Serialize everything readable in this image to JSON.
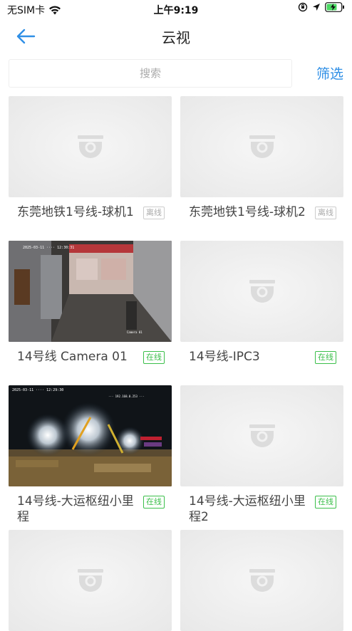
{
  "status_bar": {
    "carrier": "无SIM卡",
    "time": "上午9:19"
  },
  "nav": {
    "title": "云视"
  },
  "search": {
    "placeholder": "搜索",
    "filter_label": "筛选"
  },
  "cameras": [
    {
      "name": "东莞地铁1号线-球机1",
      "status": "离线",
      "online": false,
      "has_snapshot": false
    },
    {
      "name": "东莞地铁1号线-球机2",
      "status": "离线",
      "online": false,
      "has_snapshot": false
    },
    {
      "name": "14号线 Camera 01",
      "status": "在线",
      "online": true,
      "has_snapshot": true
    },
    {
      "name": "14号线-IPC3",
      "status": "在线",
      "online": true,
      "has_snapshot": false
    },
    {
      "name": "14号线-大运枢纽小里程",
      "status": "在线",
      "online": true,
      "has_snapshot": true
    },
    {
      "name": "14号线-大运枢纽小里程2",
      "status": "在线",
      "online": true,
      "has_snapshot": false
    },
    {
      "name": "",
      "status": "",
      "online": false,
      "has_snapshot": false
    },
    {
      "name": "",
      "status": "",
      "online": false,
      "has_snapshot": false
    }
  ],
  "colors": {
    "accent": "#2f8fe6",
    "online": "#3bbf4a",
    "offline": "#aaaaaa"
  }
}
